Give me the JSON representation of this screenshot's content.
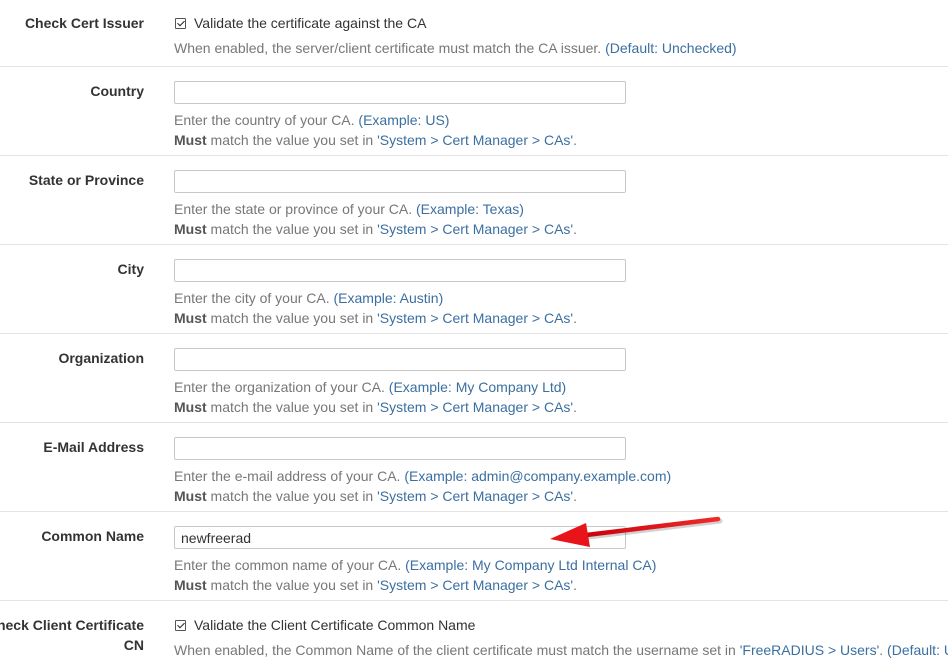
{
  "check_cert_issuer": {
    "label": "Check Cert Issuer",
    "checkbox_label": "Validate the certificate against the CA",
    "checked": true,
    "help_text": "When enabled, the server/client certificate must match the CA issuer.",
    "help_default": "(Default: Unchecked)"
  },
  "fields": [
    {
      "label": "Country",
      "value": "",
      "help_text": "Enter the country of your CA.",
      "help_example": "(Example: US)"
    },
    {
      "label": "State or Province",
      "value": "",
      "help_text": "Enter the state or province of your CA.",
      "help_example": "(Example: Texas)"
    },
    {
      "label": "City",
      "value": "",
      "help_text": "Enter the city of your CA.",
      "help_example": "(Example: Austin)"
    },
    {
      "label": "Organization",
      "value": "",
      "help_text": "Enter the organization of your CA.",
      "help_example": "(Example: My Company Ltd)"
    },
    {
      "label": "E-Mail Address",
      "value": "",
      "help_text": "Enter the e-mail address of your CA.",
      "help_example": "(Example: admin@company.example.com)"
    },
    {
      "label": "Common Name",
      "value": "newfreerad",
      "help_text": "Enter the common name of your CA.",
      "help_example": "(Example: My Company Ltd Internal CA)"
    }
  ],
  "must_match": {
    "strong": "Must",
    "text": " match the value you set in ",
    "link": "'System > Cert Manager > CAs'",
    "end": "."
  },
  "check_client_cn": {
    "label_line1": "Check Client Certificate",
    "label_line2": "CN",
    "checkbox_label": "Validate the Client Certificate Common Name",
    "checked": true,
    "help_text": "When enabled, the Common Name of the client certificate must match the username set in ",
    "help_link": "'FreeRADIUS > Users'",
    "help_after": ". ",
    "help_default": "(Default: Ur"
  },
  "colors": {
    "link": "#3b6fa0",
    "help": "#777777",
    "border": "#e3e3e3",
    "annotation_arrow": "#e8141a"
  }
}
